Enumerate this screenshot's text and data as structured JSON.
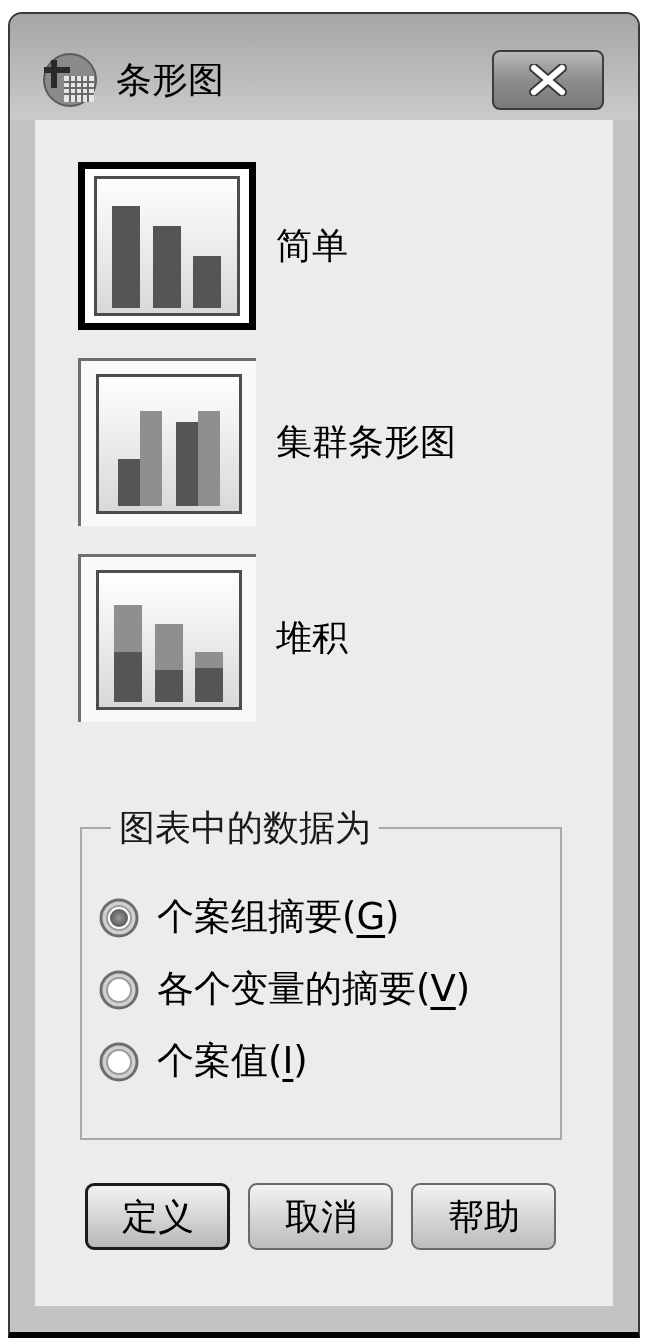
{
  "window": {
    "title": "条形图"
  },
  "chart_types": [
    {
      "kind": "simple",
      "label": "简单",
      "selected": true
    },
    {
      "kind": "clustered",
      "label": "集群条形图",
      "selected": false
    },
    {
      "kind": "stacked",
      "label": "堆积",
      "selected": false
    }
  ],
  "data_group": {
    "title": "图表中的数据为",
    "options": [
      {
        "label": "个案组摘要(",
        "access_key": "G",
        "label_end": ")",
        "selected": true
      },
      {
        "label": "各个变量的摘要(",
        "access_key": "V",
        "label_end": ")",
        "selected": false
      },
      {
        "label": "个案值(",
        "access_key": "I",
        "label_end": ")",
        "selected": false
      }
    ]
  },
  "buttons": [
    {
      "label": "定义",
      "default": true
    },
    {
      "label": "取消",
      "default": false
    },
    {
      "label": "帮助",
      "default": false
    }
  ]
}
